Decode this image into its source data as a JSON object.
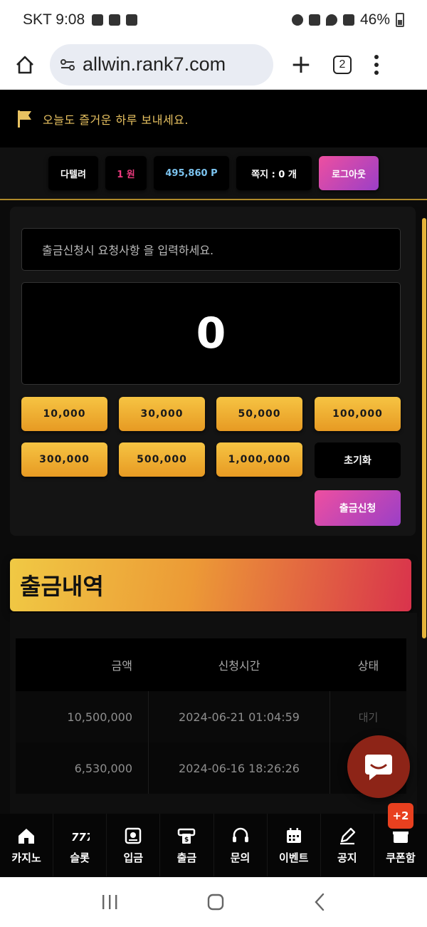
{
  "status_bar": {
    "time": "SKT 9:08",
    "battery": "46%"
  },
  "browser": {
    "url": "allwin.rank7.com",
    "tab_count": "2"
  },
  "site": {
    "greeting": "오늘도 즐거운 하루 보내세요.",
    "user": {
      "nickname": "다텔려",
      "cash": "1 원",
      "points": "495,860 P",
      "messages": "쪽지 : 0 개",
      "logout": "로그아웃"
    }
  },
  "withdraw": {
    "request_placeholder": "출금신청시 요청사항 을 입력하세요.",
    "amount": "0",
    "quick_amounts": [
      "10,000",
      "30,000",
      "50,000",
      "100,000",
      "300,000",
      "500,000",
      "1,000,000"
    ],
    "reset_label": "초기화",
    "submit_label": "출금신청"
  },
  "history": {
    "title": "출금내역",
    "columns": [
      "금액",
      "신청시간",
      "상태"
    ],
    "rows": [
      {
        "amount": "10,500,000",
        "time": "2024-06-21 01:04:59",
        "status": "대기"
      },
      {
        "amount": "6,530,000",
        "time": "2024-06-16 18:26:26",
        "status": ""
      }
    ]
  },
  "bottom_nav": {
    "items": [
      {
        "label": "카지노",
        "icon": "casino-icon"
      },
      {
        "label": "슬롯",
        "icon": "slot-icon"
      },
      {
        "label": "입금",
        "icon": "deposit-icon"
      },
      {
        "label": "출금",
        "icon": "withdraw-icon"
      },
      {
        "label": "문의",
        "icon": "headset-icon"
      },
      {
        "label": "이벤트",
        "icon": "calendar-icon"
      },
      {
        "label": "공지",
        "icon": "pencil-icon"
      },
      {
        "label": "쿠폰함",
        "icon": "coupon-icon"
      }
    ],
    "coupon_badge": "+2"
  },
  "colors": {
    "accent_gold": "#f6c443",
    "accent_pink": "#ee4fa0",
    "chat": "#8d2417"
  }
}
